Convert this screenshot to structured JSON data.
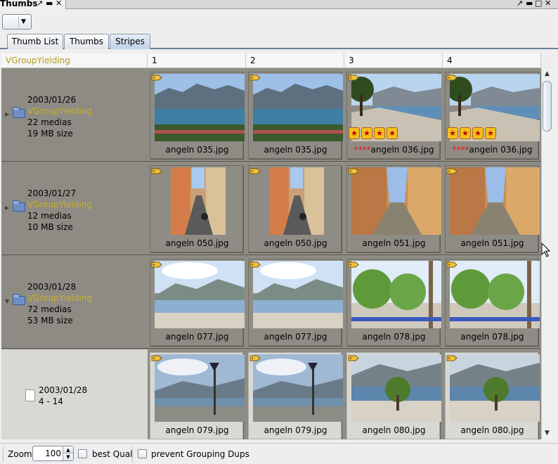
{
  "window": {
    "title": "Thumbs",
    "pin_icon": "pin-icon",
    "minimize_icon": "minimize-icon",
    "close_icon": "close-icon",
    "right_icons": [
      "undock-icon",
      "minimize-icon",
      "maximize-icon",
      "close-icon"
    ]
  },
  "tabs": [
    {
      "label": "Thumb List",
      "active": false
    },
    {
      "label": "Thumbs",
      "active": false
    },
    {
      "label": "Stripes",
      "active": true
    }
  ],
  "grid": {
    "columns": [
      "VGroupYielding",
      "1",
      "2",
      "3",
      "4"
    ],
    "rows": [
      {
        "date": "2003/01/26",
        "group": "VGroupYielding",
        "medias": "22 medias",
        "size": "19 MB size",
        "icon": "folder-icon",
        "expanded": false,
        "thumbs": [
          {
            "file": "angeln 035.jpg",
            "stars": "",
            "scene": "lake",
            "rating": 0
          },
          {
            "file": "angeln 035.jpg",
            "stars": "",
            "scene": "lake",
            "rating": 0
          },
          {
            "file": "angeln 036.jpg",
            "stars": "****",
            "scene": "promenade",
            "rating": 4
          },
          {
            "file": "angeln 036.jpg",
            "stars": "****",
            "scene": "promenade",
            "rating": 4
          }
        ]
      },
      {
        "date": "2003/01/27",
        "group": "VGroupYielding",
        "medias": "12 medias",
        "size": "10 MB size",
        "icon": "folder-icon",
        "expanded": false,
        "thumbs": [
          {
            "file": "angeln 050.jpg",
            "stars": "",
            "scene": "alley",
            "rating": 0,
            "portrait": true
          },
          {
            "file": "angeln 050.jpg",
            "stars": "",
            "scene": "alley",
            "rating": 0,
            "portrait": true
          },
          {
            "file": "angeln 051.jpg",
            "stars": "",
            "scene": "street",
            "rating": 0
          },
          {
            "file": "angeln 051.jpg",
            "stars": "",
            "scene": "street",
            "rating": 0
          }
        ]
      },
      {
        "date": "2003/01/28",
        "group": "VGroupYielding",
        "medias": "72 medias",
        "size": "53 MB size",
        "icon": "folder-icon",
        "expanded": true,
        "thumbs": [
          {
            "file": "angeln 077.jpg",
            "stars": "",
            "scene": "shore",
            "rating": 0
          },
          {
            "file": "angeln 077.jpg",
            "stars": "",
            "scene": "shore",
            "rating": 0
          },
          {
            "file": "angeln 078.jpg",
            "stars": "",
            "scene": "willows",
            "rating": 0
          },
          {
            "file": "angeln 078.jpg",
            "stars": "",
            "scene": "willows",
            "rating": 0
          }
        ]
      },
      {
        "date": "2003/01/28",
        "group": "",
        "medias": "4 - 14",
        "size": "",
        "icon": "document-icon",
        "expanded": null,
        "thumbs": [
          {
            "file": "angeln 079.jpg",
            "stars": "",
            "scene": "signpost",
            "rating": 0
          },
          {
            "file": "angeln 079.jpg",
            "stars": "",
            "scene": "signpost",
            "rating": 0
          },
          {
            "file": "angeln 080.jpg",
            "stars": "",
            "scene": "beach",
            "rating": 0
          },
          {
            "file": "angeln 080.jpg",
            "stars": "",
            "scene": "beach",
            "rating": 0
          }
        ]
      }
    ]
  },
  "statusbar": {
    "zoom_label": "Zoom",
    "zoom_value": "100",
    "best_qual_label": "best Qual",
    "best_qual_checked": false,
    "prevent_dups_label": "prevent Grouping Dups",
    "prevent_dups_checked": false
  },
  "colors": {
    "group_name": "#c8b030",
    "stars": "#e02020",
    "row_background": "#8d8b83",
    "tab_active": "#bfd1e6"
  }
}
